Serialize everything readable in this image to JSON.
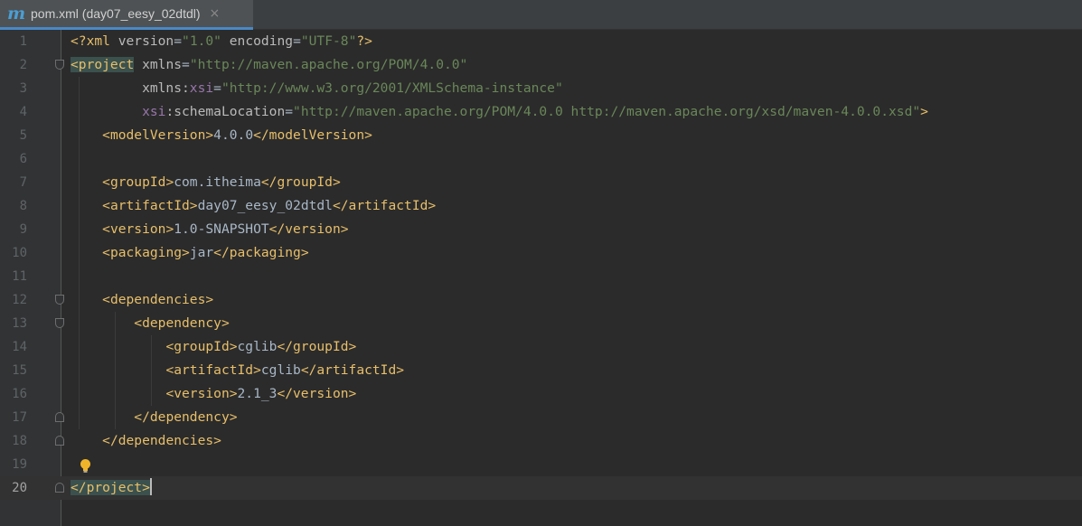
{
  "tab": {
    "icon": "maven-m-icon",
    "icon_glyph": "m",
    "title": "pom.xml (day07_eesy_02dtdl)",
    "close_glyph": "×"
  },
  "editor": {
    "current_line": 20,
    "line_numbers": [
      "1",
      "2",
      "3",
      "4",
      "5",
      "6",
      "7",
      "8",
      "9",
      "10",
      "11",
      "12",
      "13",
      "14",
      "15",
      "16",
      "17",
      "18",
      "19",
      "20"
    ],
    "lines": [
      [
        {
          "t": "tag",
          "v": "<?xml "
        },
        {
          "t": "attr",
          "v": "version"
        },
        {
          "t": "txt",
          "v": "="
        },
        {
          "t": "str",
          "v": "\"1.0\""
        },
        {
          "t": "txt",
          "v": " "
        },
        {
          "t": "attr",
          "v": "encoding"
        },
        {
          "t": "txt",
          "v": "="
        },
        {
          "t": "str",
          "v": "\"UTF-8\""
        },
        {
          "t": "tag",
          "v": "?>"
        }
      ],
      [
        {
          "t": "tag",
          "v": "<project",
          "hl": true
        },
        {
          "t": "txt",
          "v": " "
        },
        {
          "t": "attr",
          "v": "xmlns"
        },
        {
          "t": "txt",
          "v": "="
        },
        {
          "t": "str",
          "v": "\"http://maven.apache.org/POM/4.0.0\""
        }
      ],
      [
        {
          "t": "txt",
          "v": "         "
        },
        {
          "t": "attr",
          "v": "xmlns:"
        },
        {
          "t": "ns",
          "v": "xsi"
        },
        {
          "t": "txt",
          "v": "="
        },
        {
          "t": "str",
          "v": "\"http://www.w3.org/2001/XMLSchema-instance\""
        }
      ],
      [
        {
          "t": "txt",
          "v": "         "
        },
        {
          "t": "ns",
          "v": "xsi"
        },
        {
          "t": "attr",
          "v": ":schemaLocation"
        },
        {
          "t": "txt",
          "v": "="
        },
        {
          "t": "str",
          "v": "\"http://maven.apache.org/POM/4.0.0 http://maven.apache.org/xsd/maven-4.0.0.xsd\""
        },
        {
          "t": "tag",
          "v": ">"
        }
      ],
      [
        {
          "t": "txt",
          "v": "    "
        },
        {
          "t": "tag",
          "v": "<modelVersion>"
        },
        {
          "t": "txt",
          "v": "4.0.0"
        },
        {
          "t": "tag",
          "v": "</modelVersion>"
        }
      ],
      [],
      [
        {
          "t": "txt",
          "v": "    "
        },
        {
          "t": "tag",
          "v": "<groupId>"
        },
        {
          "t": "txt",
          "v": "com.itheima"
        },
        {
          "t": "tag",
          "v": "</groupId>"
        }
      ],
      [
        {
          "t": "txt",
          "v": "    "
        },
        {
          "t": "tag",
          "v": "<artifactId>"
        },
        {
          "t": "txt",
          "v": "day07_eesy_02dtdl"
        },
        {
          "t": "tag",
          "v": "</artifactId>"
        }
      ],
      [
        {
          "t": "txt",
          "v": "    "
        },
        {
          "t": "tag",
          "v": "<version>"
        },
        {
          "t": "txt",
          "v": "1.0-SNAPSHOT"
        },
        {
          "t": "tag",
          "v": "</version>"
        }
      ],
      [
        {
          "t": "txt",
          "v": "    "
        },
        {
          "t": "tag",
          "v": "<packaging>"
        },
        {
          "t": "txt",
          "v": "jar"
        },
        {
          "t": "tag",
          "v": "</packaging>"
        }
      ],
      [],
      [
        {
          "t": "txt",
          "v": "    "
        },
        {
          "t": "tag",
          "v": "<dependencies>"
        }
      ],
      [
        {
          "t": "txt",
          "v": "        "
        },
        {
          "t": "tag",
          "v": "<dependency>"
        }
      ],
      [
        {
          "t": "txt",
          "v": "            "
        },
        {
          "t": "tag",
          "v": "<groupId>"
        },
        {
          "t": "txt",
          "v": "cglib"
        },
        {
          "t": "tag",
          "v": "</groupId>"
        }
      ],
      [
        {
          "t": "txt",
          "v": "            "
        },
        {
          "t": "tag",
          "v": "<artifactId>"
        },
        {
          "t": "txt",
          "v": "cglib"
        },
        {
          "t": "tag",
          "v": "</artifactId>"
        }
      ],
      [
        {
          "t": "txt",
          "v": "            "
        },
        {
          "t": "tag",
          "v": "<version>"
        },
        {
          "t": "txt",
          "v": "2.1_3"
        },
        {
          "t": "tag",
          "v": "</version>"
        }
      ],
      [
        {
          "t": "txt",
          "v": "        "
        },
        {
          "t": "tag",
          "v": "</dependency>"
        }
      ],
      [
        {
          "t": "txt",
          "v": "    "
        },
        {
          "t": "tag",
          "v": "</dependencies>"
        }
      ],
      [],
      [
        {
          "t": "tag",
          "v": "</project>",
          "hl": true
        },
        {
          "t": "caret",
          "v": ""
        }
      ]
    ],
    "fold_markers": [
      {
        "line": 2,
        "kind": "open"
      },
      {
        "line": 12,
        "kind": "open"
      },
      {
        "line": 13,
        "kind": "open"
      },
      {
        "line": 17,
        "kind": "close"
      },
      {
        "line": 18,
        "kind": "close"
      },
      {
        "line": 20,
        "kind": "close"
      }
    ],
    "intention_bulb_line": 19,
    "colors": {
      "background": "#2b2b2b",
      "tag": "#e8bf6a",
      "attribute": "#bababa",
      "namespace": "#9876aa",
      "string": "#6a8759",
      "text": "#a9b7c6",
      "tag_match_highlight": "#3b514d",
      "tab_underline": "#4a88c7"
    }
  }
}
